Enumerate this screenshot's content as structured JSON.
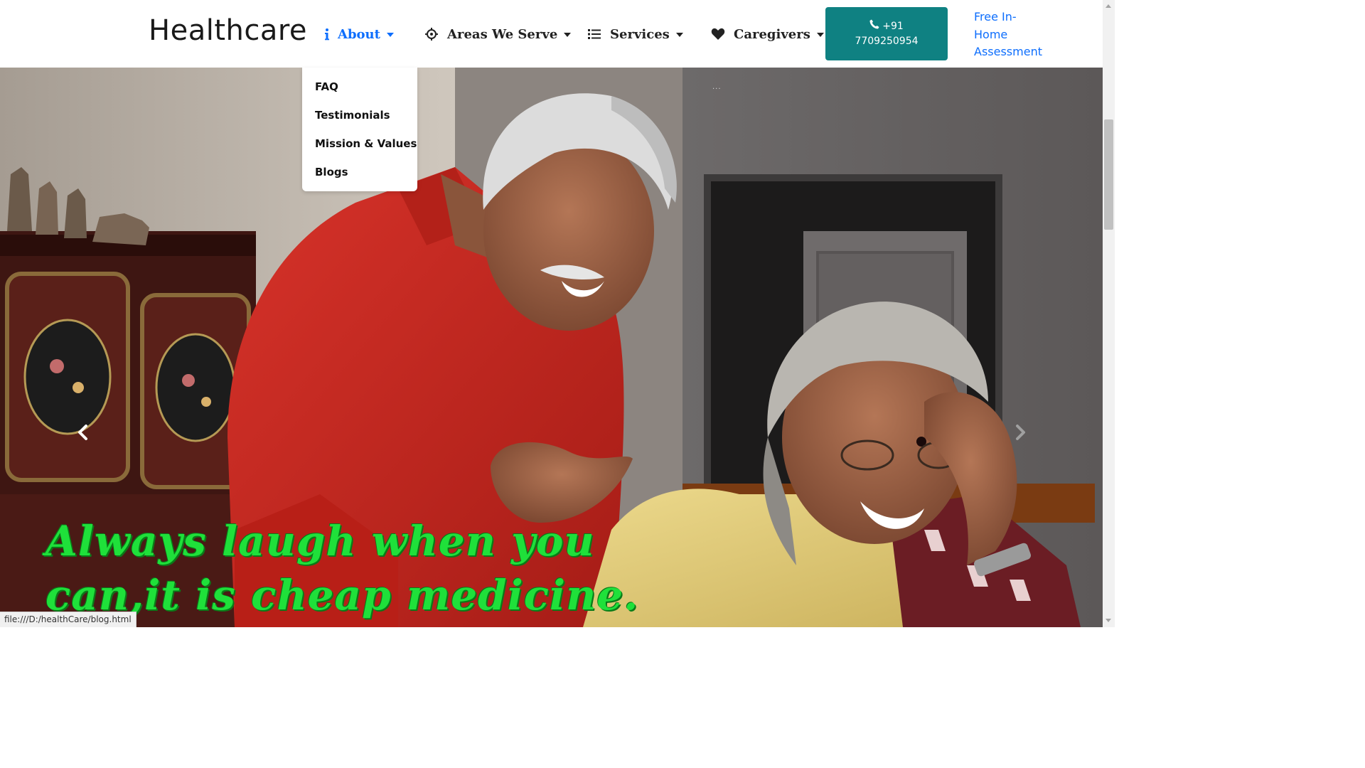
{
  "brand": "Healthcare",
  "nav": {
    "about": "About",
    "areas": "Areas We Serve",
    "services": "Services",
    "caregivers": "Caregivers"
  },
  "about_menu": {
    "items": [
      "FAQ",
      "Testimonials",
      "Mission & Values",
      "Blogs"
    ]
  },
  "call_button": {
    "line1": "+91",
    "line2": "7709250954"
  },
  "assessment_link": {
    "line1": "Free In-",
    "line2": "Home",
    "line3": "Assessment"
  },
  "hero": {
    "caption_line1": "Always laugh when you",
    "caption_line2": "can,it is cheap medicine.",
    "indicator": "..."
  },
  "status_bar": {
    "url": "file:///D:/healthCare/blog.html"
  },
  "icons": {
    "about": "info-icon",
    "areas": "crosshairs-icon",
    "services": "list-icon",
    "caregivers": "heart-icon",
    "call": "phone-icon",
    "prev": "chevron-left-icon",
    "next": "chevron-right-icon"
  },
  "colors": {
    "link_blue": "#0d6efd",
    "call_button_bg": "#0f8182",
    "caption_green": "#1fe03a"
  }
}
